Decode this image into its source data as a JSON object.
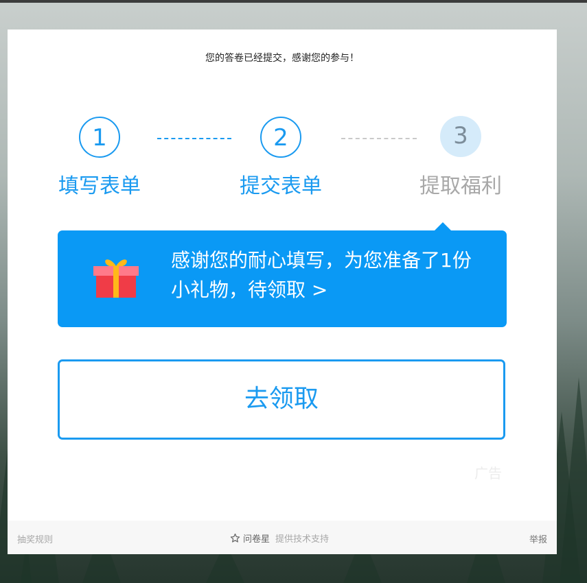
{
  "header": {
    "thanks": "您的答卷已经提交，感谢您的参与！"
  },
  "steps": [
    {
      "number": "1",
      "label": "填写表单"
    },
    {
      "number": "2",
      "label": "提交表单"
    },
    {
      "number": "3",
      "label": "提取福利"
    }
  ],
  "promo": {
    "text": "感谢您的耐心填写，为您准备了1份小礼物，待领取 >"
  },
  "claim_button": {
    "label": "去领取"
  },
  "ad_label": "广告",
  "footer": {
    "rules": "抽奖规则",
    "brand": "问卷星",
    "support": "提供技术支持",
    "report": "举报"
  },
  "colors": {
    "accent": "#1a9af0",
    "promo_bg": "#0a99f5",
    "inactive": "#a8a8a8"
  },
  "icons": {
    "gift": "gift-icon",
    "star": "star-outline-icon"
  }
}
